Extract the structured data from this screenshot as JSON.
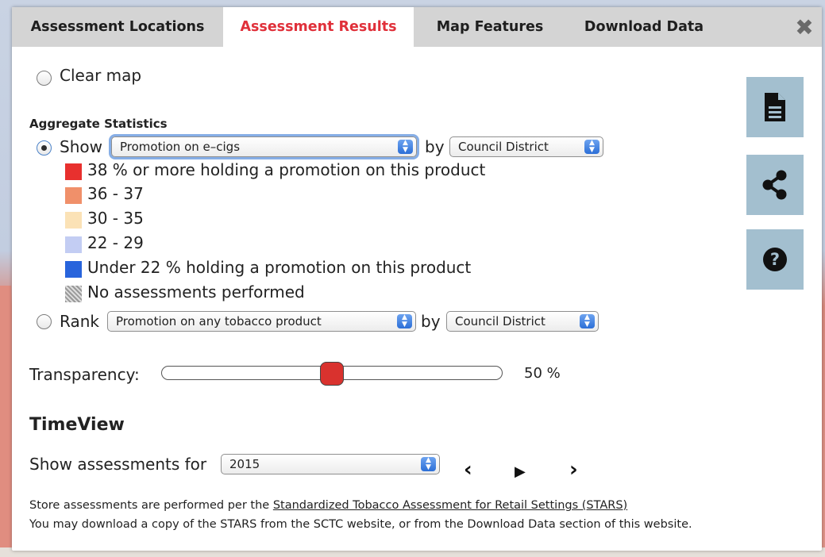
{
  "tabs": {
    "locations": "Assessment Locations",
    "results": "Assessment Results",
    "features": "Map Features",
    "download": "Download Data"
  },
  "close_icon": "close-icon",
  "clear_map_label": "Clear map",
  "aggregate_title": "Aggregate Statistics",
  "show": {
    "label": "Show",
    "measure": "Promotion on e–cigs",
    "by": "by",
    "group": "Council District"
  },
  "legend": [
    {
      "color": "#e8302e",
      "label": "38 % or more holding a promotion on this product"
    },
    {
      "color": "#f0906a",
      "label": "36 - 37"
    },
    {
      "color": "#fbe2b6",
      "label": "30 - 35"
    },
    {
      "color": "#c3cdf3",
      "label": "22 - 29"
    },
    {
      "color": "#2864dc",
      "label": "Under 22 % holding a promotion on this product"
    },
    {
      "color": "#b8b8b8",
      "label": "No assessments performed"
    }
  ],
  "rank": {
    "label": "Rank",
    "measure": "Promotion on any tobacco product",
    "by": "by",
    "group": "Council District"
  },
  "transparency": {
    "label": "Transparency:",
    "value": 50,
    "value_text": "50 %"
  },
  "timeview": {
    "title": "TimeView",
    "label": "Show assessments for",
    "year": "2015",
    "prev": "‹",
    "play": "▶",
    "next": "›"
  },
  "notes": {
    "line1_prefix": "Store assessments are performed per the ",
    "line1_link": "Standardized Tobacco Assessment for Retail Settings (STARS)",
    "line2": "You may download a copy of the STARS from the SCTC website, or from the Download Data section of this website."
  },
  "side_buttons": [
    "document-icon",
    "share-icon",
    "help-icon"
  ]
}
